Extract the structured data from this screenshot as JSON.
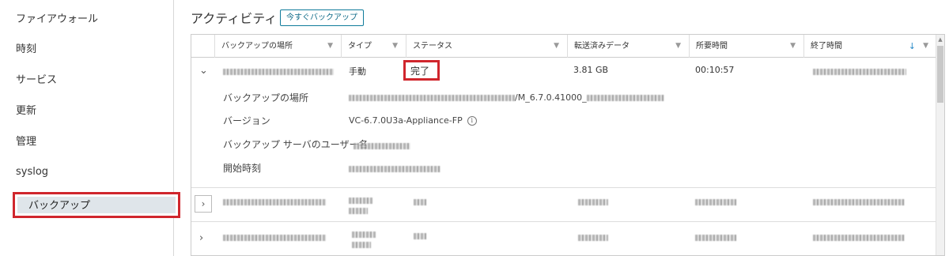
{
  "sidebar": {
    "items": [
      {
        "label": "ファイアウォール"
      },
      {
        "label": "時刻"
      },
      {
        "label": "サービス"
      },
      {
        "label": "更新"
      },
      {
        "label": "管理"
      },
      {
        "label": "syslog"
      }
    ],
    "active_label": "バックアップ"
  },
  "header": {
    "title": "アクティビティ",
    "backup_now_label": "今すぐバックアップ"
  },
  "table": {
    "columns": [
      {
        "label": "バックアップの場所"
      },
      {
        "label": "タイプ"
      },
      {
        "label": "ステータス"
      },
      {
        "label": "転送済みデータ"
      },
      {
        "label": "所要時間"
      },
      {
        "label": "終了時間"
      }
    ],
    "sort_icon": "sort-down-icon",
    "filter_icon": "filter-icon",
    "expanded_row": {
      "type": "手動",
      "status": "完了",
      "data_transferred": "3.81 GB",
      "duration": "00:10:57",
      "details": {
        "location_label": "バックアップの場所",
        "location_value_suffix": "/M_6.7.0.41000_",
        "version_label": "バージョン",
        "version_value": "VC-6.7.0U3a-Appliance-FP",
        "user_label": "バックアップ サーバのユーザー名",
        "start_label": "開始時刻"
      }
    }
  },
  "colors": {
    "accent": "#0f7b9a",
    "highlight_red": "#d0262d",
    "active_bg": "#dfe5ea"
  }
}
